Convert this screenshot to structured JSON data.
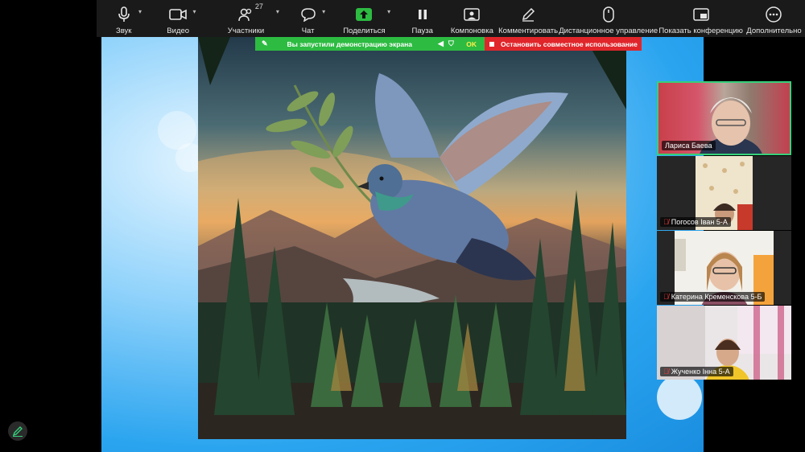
{
  "toolbar": {
    "items": [
      {
        "label": "Звук",
        "icon": "microphone-icon"
      },
      {
        "label": "Видео",
        "icon": "video-camera-icon"
      },
      {
        "label": "Участники",
        "icon": "participants-icon",
        "count": "27"
      },
      {
        "label": "Чат",
        "icon": "chat-icon"
      },
      {
        "label": "Поделиться",
        "icon": "share-screen-icon"
      },
      {
        "label": "Пауза",
        "icon": "pause-icon"
      },
      {
        "label": "Компоновка",
        "icon": "layout-icon"
      },
      {
        "label": "Комментировать",
        "icon": "pencil-icon"
      },
      {
        "label": "Дистанционное управление",
        "icon": "mouse-icon"
      },
      {
        "label": "Показать конференцию",
        "icon": "show-meeting-icon"
      },
      {
        "label": "Дополнительно",
        "icon": "more-icon"
      }
    ]
  },
  "share_banner": {
    "status": "Вы запустили демонстрацию экрана",
    "ok": "OK",
    "stop": "Остановить совместное использование",
    "colors": {
      "green": "#2dbb42",
      "red": "#e0262b",
      "ok": "#ffef4a"
    }
  },
  "participants": [
    {
      "name": "Лариса Баева",
      "muted": false,
      "active": true
    },
    {
      "name": "Погосов Іван 5-А",
      "muted": true,
      "active": false
    },
    {
      "name": "Катерина Кременскова 5-Б",
      "muted": true,
      "active": false
    },
    {
      "name": "Жученко Інна 5-А",
      "muted": true,
      "active": false
    }
  ],
  "colors": {
    "active_border": "#36d07a",
    "mic_off": "#ff3b3b",
    "toolbar_bg": "#1a1a1a"
  }
}
